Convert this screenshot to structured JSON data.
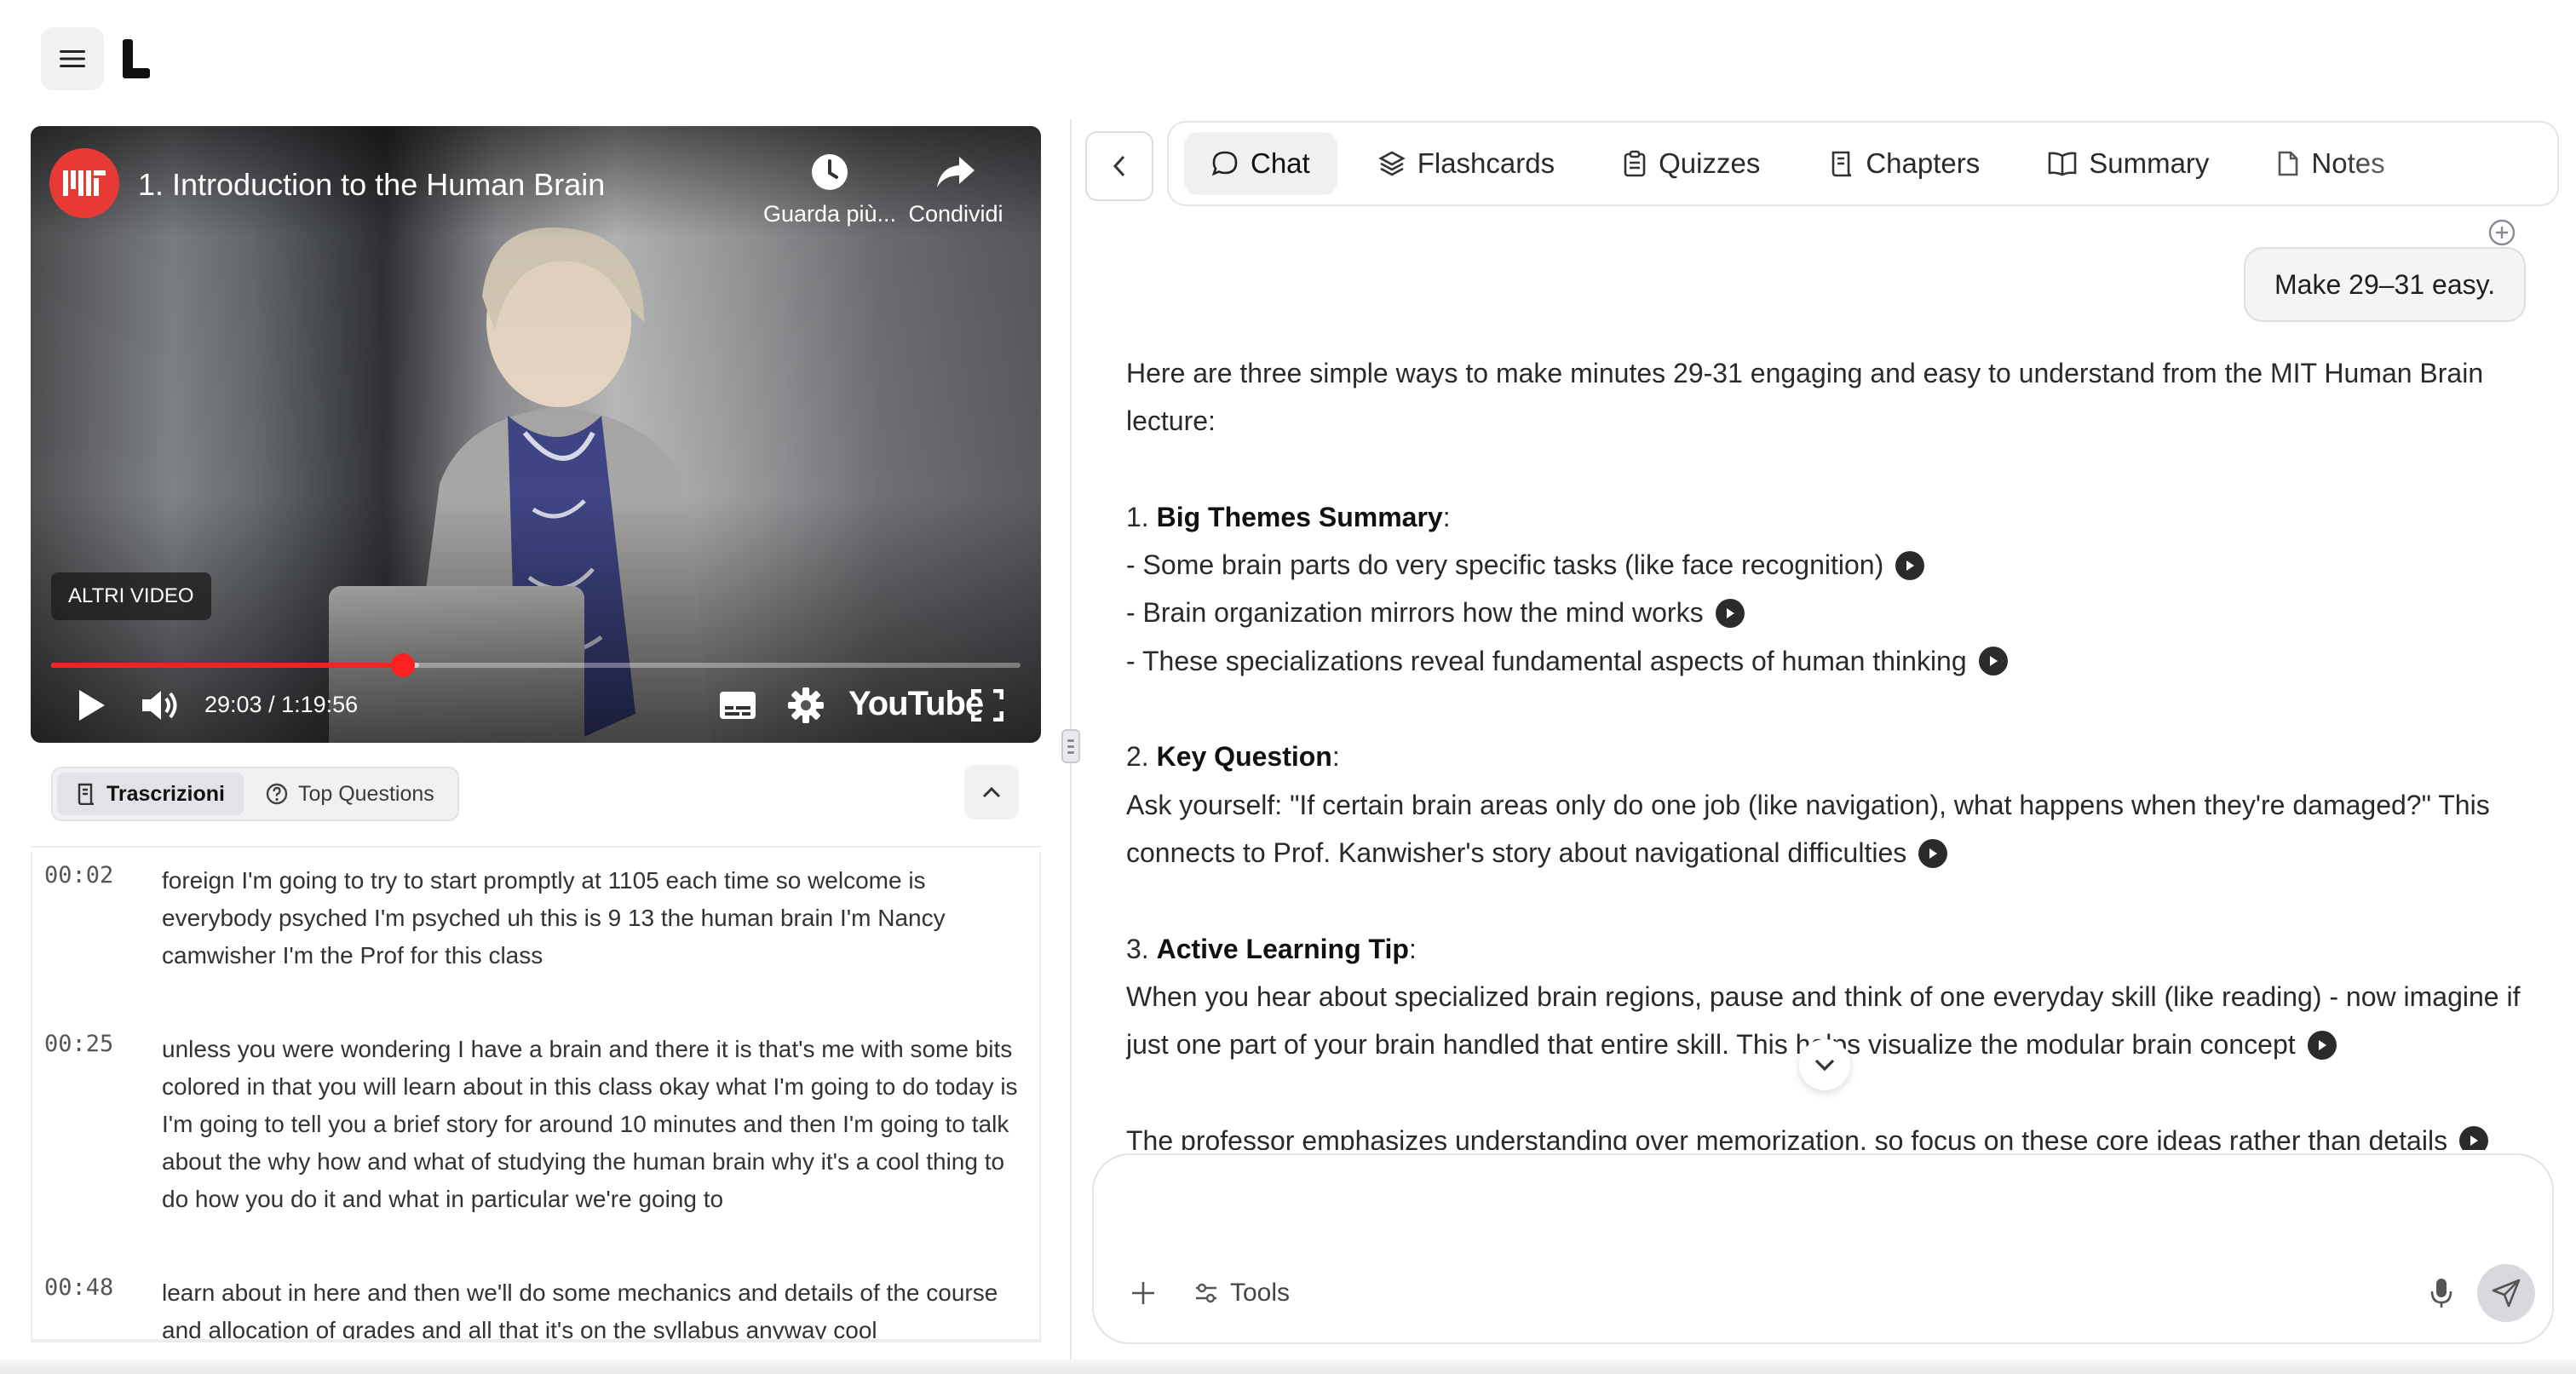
{
  "app": {
    "menu_icon": "hamburger-icon",
    "logo_icon": "brand-logo-icon"
  },
  "video": {
    "title": "1. Introduction to the Human Brain",
    "channel_icon": "mit-logo-icon",
    "watch_later_label": "Guarda più...",
    "share_label": "Condividi",
    "more_videos_label": "ALTRI VIDEO",
    "time_readout": "29:03 / 1:19:56",
    "played_fraction": 0.3633,
    "buffered_fraction": 0.38,
    "youtube_label": "YouTube"
  },
  "left_tabs": {
    "transcripts_label": "Trascrizioni",
    "questions_label": "Top Questions"
  },
  "transcript": [
    {
      "time": "00:02",
      "text": "foreign I'm going to try to start promptly at 1105 each time so welcome is everybody psyched I'm psyched uh this is 9 13 the human brain I'm Nancy camwisher I'm the Prof for this class"
    },
    {
      "time": "00:25",
      "text": "unless you were wondering I have a brain and there it is that's me with some bits colored in that you will learn about in this class okay what I'm going to do today is I'm going to tell you a brief story for around 10 minutes and then I'm going to talk about the why how and what of studying the human brain why it's a cool thing to do how you do it and what in particular we're going to"
    },
    {
      "time": "00:48",
      "text": "learn about in here and then we'll do some mechanics and details of the course and allocation of grades and all that it's on the syllabus anyway cool"
    }
  ],
  "right_tabs": [
    {
      "label": "Chat",
      "icon": "chat-bubble-icon"
    },
    {
      "label": "Flashcards",
      "icon": "layers-icon"
    },
    {
      "label": "Quizzes",
      "icon": "clipboard-icon"
    },
    {
      "label": "Chapters",
      "icon": "scroll-icon"
    },
    {
      "label": "Summary",
      "icon": "book-open-icon"
    },
    {
      "label": "Notes",
      "icon": "file-icon"
    }
  ],
  "chat": {
    "user_message": "Make 29–31 easy.",
    "intro": "Here are three simple ways to make minutes 29-31 engaging and easy to understand from the MIT Human Brain lecture:",
    "s1_num": "1.",
    "s1_title": "Big Themes Summary",
    "s1_b1": "- Some brain parts do very specific tasks (like face recognition)",
    "s1_b2": "- Brain organization mirrors how the mind works",
    "s1_b3": "- These specializations reveal fundamental aspects of human thinking",
    "s2_num": "2.",
    "s2_title": "Key Question",
    "s2_body": "Ask yourself: \"If certain brain areas only do one job (like navigation), what happens when they're damaged?\" This connects to Prof. Kanwisher's story about navigational difficulties",
    "s3_num": "3.",
    "s3_title": "Active Learning Tip",
    "s3_body": "When you hear about specialized brain regions, pause and think of one everyday skill (like reading) - now imagine if just one part of your brain handled that entire skill. This helps visualize the modular brain concept",
    "closing": "The professor emphasizes understanding over memorization, so focus on these core ideas rather than details"
  },
  "composer": {
    "placeholder": "",
    "tools_label": "Tools"
  }
}
